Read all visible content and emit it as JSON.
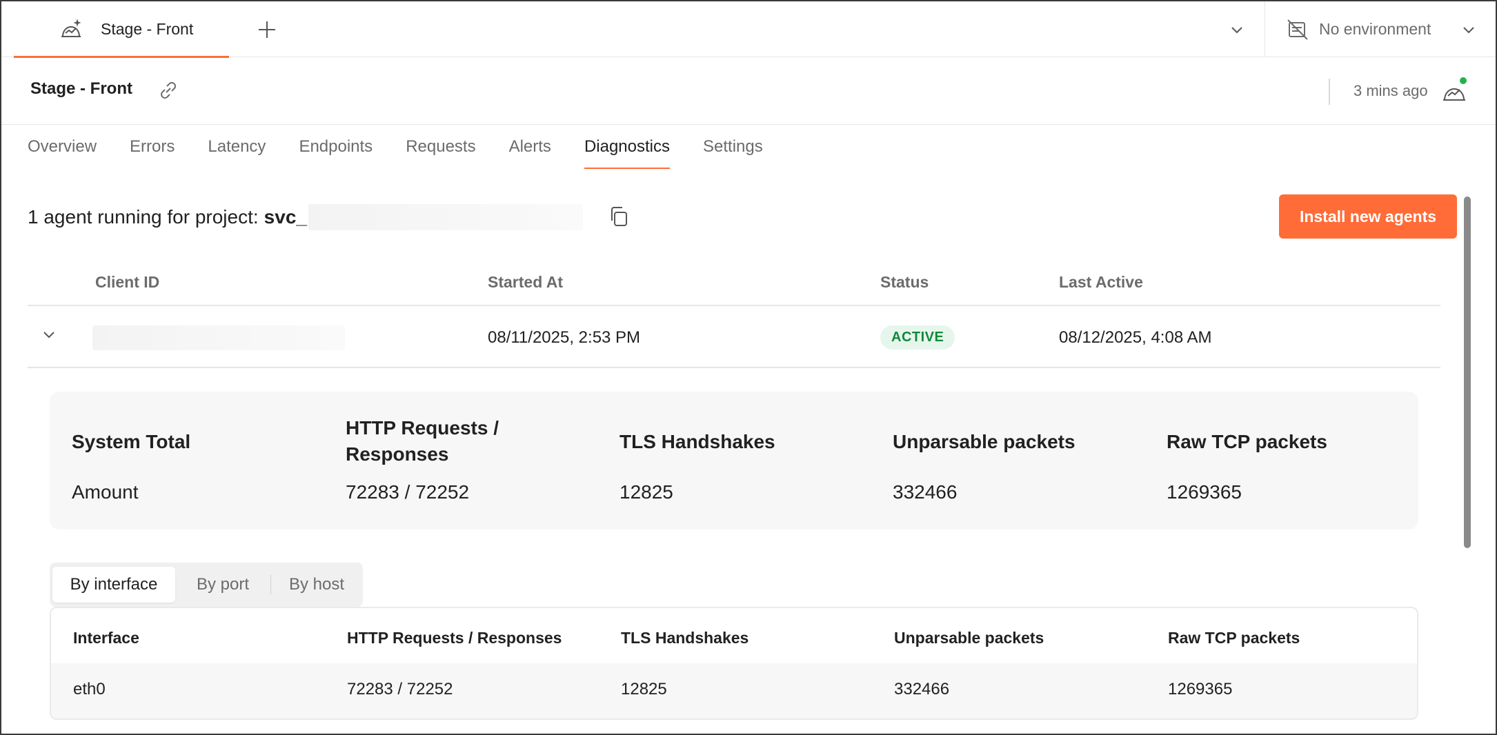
{
  "tabbar": {
    "active_tab_label": "Stage - Front",
    "environment_label": "No environment"
  },
  "header": {
    "title": "Stage - Front",
    "updated": "3 mins ago"
  },
  "subnav": [
    "Overview",
    "Errors",
    "Latency",
    "Endpoints",
    "Requests",
    "Alerts",
    "Diagnostics",
    "Settings"
  ],
  "subnav_active": "Diagnostics",
  "agents": {
    "summary_prefix": "1 agent running for project:",
    "project_prefix": "svc_",
    "install_button": "Install new agents",
    "columns": [
      "Client ID",
      "Started At",
      "Status",
      "Last Active"
    ],
    "rows": [
      {
        "started_at": "08/11/2025, 2:53 PM",
        "status": "ACTIVE",
        "last_active": "08/12/2025, 4:08 AM"
      }
    ]
  },
  "totals": {
    "headers": [
      "System Total",
      "HTTP Requests / Responses",
      "TLS Handshakes",
      "Unparsable packets",
      "Raw TCP packets"
    ],
    "values": [
      "Amount",
      "72283 / 72252",
      "12825",
      "332466",
      "1269365"
    ]
  },
  "breakdown": {
    "tabs": [
      "By interface",
      "By port",
      "By host"
    ],
    "active_tab": "By interface",
    "columns": [
      "Interface",
      "HTTP Requests / Responses",
      "TLS Handshakes",
      "Unparsable packets",
      "Raw TCP packets"
    ],
    "rows": [
      [
        "eth0",
        "72283 / 72252",
        "12825",
        "332466",
        "1269365"
      ]
    ]
  },
  "colors": {
    "accent": "#ff6c37",
    "status_active_bg": "#e6f6ec",
    "status_active_text": "#0e8a3a",
    "online_dot": "#22b24c"
  },
  "icons": {
    "tab": "monitor-icon",
    "new_tab": "plus-icon",
    "tabs_menu": "chevron-down-icon",
    "environment": "no-environment-icon",
    "link": "link-icon",
    "copy": "copy-icon",
    "row_expand": "chevron-down-icon"
  }
}
